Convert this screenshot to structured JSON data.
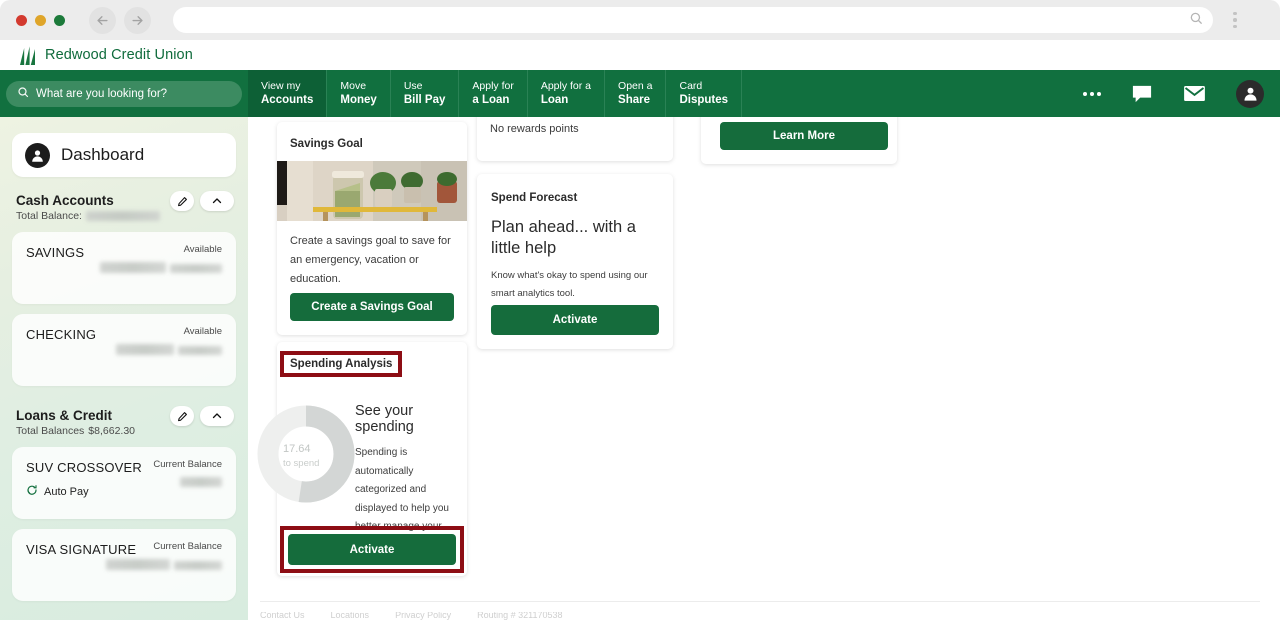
{
  "browser": {
    "back_icon": "back-arrow-icon",
    "forward_icon": "forward-arrow-icon",
    "url_value": "",
    "url_placeholder": "",
    "search_icon": "search-icon",
    "menu_icon": "kebab-menu-icon"
  },
  "brand": {
    "name": "Redwood Credit Union",
    "logo_icon": "redwood-trees-logo-icon",
    "color": "#0f6b3c"
  },
  "search": {
    "placeholder": "What are you looking for?",
    "icon": "search-icon"
  },
  "nav": {
    "items": [
      {
        "line1": "View my",
        "line2": "Accounts",
        "active": true
      },
      {
        "line1": "Move",
        "line2": "Money",
        "active": false
      },
      {
        "line1": "Use",
        "line2": "Bill Pay",
        "active": false
      },
      {
        "line1": "Apply for",
        "line2": "a Loan",
        "active": false
      },
      {
        "line1": "Apply for a",
        "line2": "Loan",
        "active": false
      },
      {
        "line1": "Open a",
        "line2": "Share",
        "active": false
      },
      {
        "line1": "Card",
        "line2": "Disputes",
        "active": false
      }
    ],
    "icons": [
      {
        "name": "more-options-icon"
      },
      {
        "name": "chat-message-icon"
      },
      {
        "name": "mail-envelope-icon"
      },
      {
        "name": "user-account-icon"
      }
    ],
    "bar_color": "#11703f",
    "active_color": "#0d6036"
  },
  "sidebar": {
    "dashboard": {
      "label": "Dashboard",
      "icon": "user-avatar-icon"
    },
    "groups": [
      {
        "title": "Cash Accounts",
        "subtitle_label": "Total Balance:",
        "subtitle_value": "",
        "subtitle_redacted": true,
        "edit_icon": "pencil-edit-icon",
        "collapse_icon": "chevron-up-icon",
        "accounts": [
          {
            "name": "SAVINGS",
            "balance_label": "Available",
            "balance_value": "",
            "redacted": true
          },
          {
            "name": "CHECKING",
            "balance_label": "Available",
            "balance_value": "",
            "redacted": true
          }
        ]
      },
      {
        "title": "Loans & Credit",
        "subtitle_label": "Total Balances",
        "subtitle_value": "$8,662.30",
        "subtitle_redacted": false,
        "edit_icon": "pencil-edit-icon",
        "collapse_icon": "chevron-up-icon",
        "accounts": [
          {
            "name": "SUV CROSSOVER",
            "balance_label": "Current Balance",
            "balance_value": "",
            "redacted": true,
            "tag": "Auto Pay",
            "tag_icon": "auto-pay-refresh-icon"
          },
          {
            "name": "VISA SIGNATURE",
            "balance_label": "Current Balance",
            "balance_value": "",
            "redacted": true
          }
        ]
      }
    ]
  },
  "main": {
    "savings_goal": {
      "title": "Savings Goal",
      "image_alt": "money-jar-photo",
      "description": "Create a savings goal to save for an emergency, vacation or education.",
      "button_label": "Create a Savings Goal"
    },
    "spending_analysis": {
      "title": "Spending Analysis",
      "heading": "See your spending",
      "description": "Spending is automatically categorized and displayed to help you better manage your money.",
      "button_label": "Activate",
      "donut_amount": "17.64",
      "donut_caption": "to spend"
    },
    "rewards": {
      "text": "No rewards points"
    },
    "spend_forecast": {
      "title": "Spend Forecast",
      "heading": "Plan ahead... with a little help",
      "description": "Know what's okay to spend using our smart analytics tool.",
      "button_label": "Activate"
    },
    "learn_more": {
      "button_label": "Learn More"
    },
    "footer_links": [
      "Contact Us",
      "Locations",
      "Privacy Policy",
      "Routing # 321170538"
    ]
  },
  "annotations": {
    "highlight_color": "#8d0d14",
    "boxes": [
      {
        "target": "spending-analysis-title"
      },
      {
        "target": "spending-analysis-activate-button"
      }
    ]
  },
  "theme": {
    "brand_green": "#11703f",
    "button_green": "#156c3c",
    "sidebar_gradient_start": "#eef3e2",
    "sidebar_gradient_end": "#d8ecdf"
  }
}
